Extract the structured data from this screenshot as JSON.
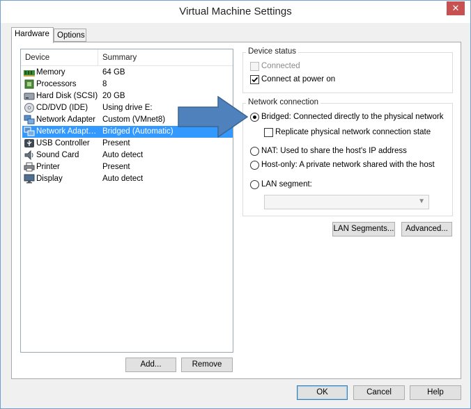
{
  "window": {
    "title": "Virtual Machine Settings",
    "close_glyph": "✕"
  },
  "tabs": [
    {
      "label": "Hardware",
      "active": true
    },
    {
      "label": "Options",
      "active": false
    }
  ],
  "device_list": {
    "columns": [
      "Device",
      "Summary"
    ],
    "rows": [
      {
        "device": "Memory",
        "summary": "64 GB",
        "icon": "memory-icon"
      },
      {
        "device": "Processors",
        "summary": "8",
        "icon": "processor-icon"
      },
      {
        "device": "Hard Disk (SCSI)",
        "summary": "20 GB",
        "icon": "hard-disk-icon"
      },
      {
        "device": "CD/DVD (IDE)",
        "summary": "Using drive E:",
        "icon": "cd-dvd-icon"
      },
      {
        "device": "Network Adapter",
        "summary": "Custom (VMnet8)",
        "icon": "network-adapter-icon"
      },
      {
        "device": "Network Adapt…",
        "summary": "Bridged (Automatic)",
        "icon": "network-adapter-icon",
        "selected": true
      },
      {
        "device": "USB Controller",
        "summary": "Present",
        "icon": "usb-icon"
      },
      {
        "device": "Sound Card",
        "summary": "Auto detect",
        "icon": "sound-card-icon"
      },
      {
        "device": "Printer",
        "summary": "Present",
        "icon": "printer-icon"
      },
      {
        "device": "Display",
        "summary": "Auto detect",
        "icon": "display-icon"
      }
    ]
  },
  "list_buttons": {
    "add": "Add...",
    "remove": "Remove"
  },
  "device_status": {
    "group_label": "Device status",
    "connected": {
      "label": "Connected",
      "checked": false,
      "enabled": false
    },
    "connect_at_power_on": {
      "label": "Connect at power on",
      "checked": true,
      "enabled": true
    }
  },
  "network_connection": {
    "group_label": "Network connection",
    "bridged": {
      "label": "Bridged: Connected directly to the physical network",
      "selected": true
    },
    "replicate": {
      "label": "Replicate physical network connection state",
      "checked": false
    },
    "nat": {
      "label": "NAT: Used to share the host's IP address",
      "selected": false
    },
    "host_only": {
      "label": "Host-only: A private network shared with the host",
      "selected": false
    },
    "lan_segment": {
      "label": "LAN segment:",
      "selected": false,
      "value": ""
    }
  },
  "network_buttons": {
    "lan_segments": "LAN Segments...",
    "advanced": "Advanced..."
  },
  "dialog_buttons": {
    "ok": "OK",
    "cancel": "Cancel",
    "help": "Help"
  },
  "colors": {
    "selection": "#3399ff",
    "arrow_fill": "#4f81bd",
    "arrow_stroke": "#3a6592",
    "close_button": "#c75050"
  }
}
